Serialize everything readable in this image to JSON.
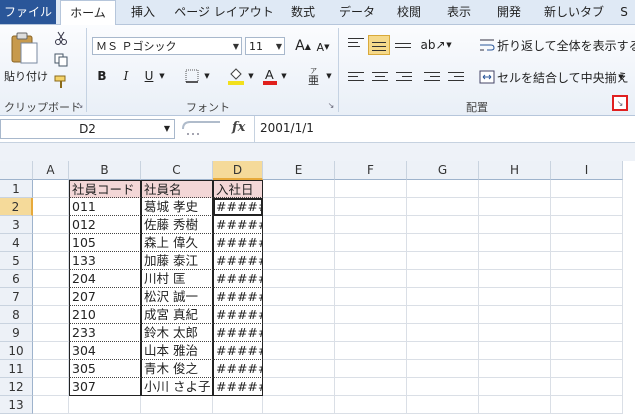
{
  "tabs": [
    "ファイル",
    "ホーム",
    "挿入",
    "ページ レイアウト",
    "数式",
    "データ",
    "校閲",
    "表示",
    "開発",
    "新しいタブ",
    "S"
  ],
  "ribbon": {
    "clipboard": {
      "paste_label": "貼り付け",
      "group_label": "クリップボード"
    },
    "font": {
      "font_name": "ＭＳ Ｐゴシック",
      "font_size": "11",
      "bold": "B",
      "italic": "I",
      "underline": "U",
      "group_label": "フォント",
      "grow_label": "A",
      "shrink_label": "A"
    },
    "alignment": {
      "wrap_label": "折り返して全体を表示する",
      "merge_label": "セルを結合して中央揃え",
      "group_label": "配置"
    }
  },
  "formula_bar": {
    "name_box": "D2",
    "fx_label": "fx",
    "value": "2001/1/1"
  },
  "grid": {
    "columns": [
      "A",
      "B",
      "C",
      "D",
      "E",
      "F",
      "G",
      "H",
      "I"
    ],
    "rows": [
      "1",
      "2",
      "3",
      "4",
      "5",
      "6",
      "7",
      "8",
      "9",
      "10",
      "11",
      "12",
      "13"
    ],
    "header_row": [
      "社員コード",
      "社員名",
      "入社日"
    ],
    "data_rows": [
      [
        "011",
        "葛城 孝史",
        "#####"
      ],
      [
        "012",
        "佐藤 秀樹",
        "#####"
      ],
      [
        "105",
        "森上 偉久",
        "#####"
      ],
      [
        "133",
        "加藤 泰江",
        "#####"
      ],
      [
        "204",
        "川村 匡",
        "#####"
      ],
      [
        "207",
        "松沢 誠一",
        "#####"
      ],
      [
        "210",
        "成宮 真紀",
        "#####"
      ],
      [
        "233",
        "鈴木 太郎",
        "#####"
      ],
      [
        "304",
        "山本 雅治",
        "#####"
      ],
      [
        "305",
        "青木 俊之",
        "#####"
      ],
      [
        "307",
        "小川 さよ子",
        "#####"
      ]
    ]
  },
  "colors": {
    "file_tab": "#2a5699",
    "selected_header": "#f5da9a",
    "header_fill": "#f3d7d7",
    "highlight_box": "#e02020"
  }
}
